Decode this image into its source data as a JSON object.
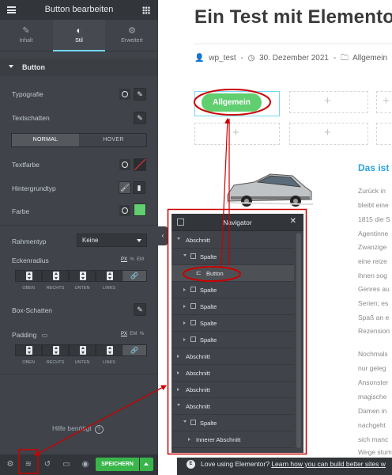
{
  "panel": {
    "title": "Button bearbeiten",
    "tabs": [
      {
        "label": "Inhalt",
        "icon": "pencil-icon"
      },
      {
        "label": "Stil",
        "icon": "contrast-icon"
      },
      {
        "label": "Erweitert",
        "icon": "gear-icon"
      }
    ],
    "section": "Button",
    "typography": "Typografie",
    "text_shadow": "Textschatten",
    "state_normal": "NORMAL",
    "state_hover": "HOVER",
    "text_color": "Textfarbe",
    "background_type": "Hintergrundtyp",
    "color": "Farbe",
    "color_value": "#61ce70",
    "border_type": "Rahmentyp",
    "border_type_value": "Keine",
    "corner_radius": "Eckenradius",
    "unit_px": "PX",
    "unit_percent": "%",
    "unit_em": "EM",
    "dim_top": "OBEN",
    "dim_right": "RECHTS",
    "dim_bottom": "UNTEN",
    "dim_left": "LINKS",
    "box_shadow": "Box-Schatten",
    "padding": "Padding",
    "help": "Hilfe benötigt",
    "save": "SPEICHERN"
  },
  "preview": {
    "title": "Ein Test mit Elementor",
    "author": "wp_test",
    "date": "30. Dezember 2021",
    "category": "Allgemein",
    "button_label": "Allgemein",
    "heading": "Das ist",
    "paragraph1": [
      "Zurück in",
      "bleibt eine",
      "1815 die S",
      "Agentinne",
      "Zwanzige",
      "eine reize",
      "ihnen sog",
      "Genres au",
      "Serien; es",
      "Spaß an e",
      "Rezension"
    ],
    "paragraph2": [
      "Nochmals",
      "nur geleg",
      "Ansonster",
      "magische",
      "Damen in",
      "nachgeht",
      "sich manc",
      "Wege stum"
    ],
    "notice": "Love using Elementor?",
    "notice_link": "Learn how you can build better sites w"
  },
  "navigator": {
    "title": "Navigator",
    "rows": [
      {
        "label": "Abschnitt"
      },
      {
        "label": "Spalte"
      },
      {
        "label": "Button"
      },
      {
        "label": "Spalte"
      },
      {
        "label": "Spalte"
      },
      {
        "label": "Spalte"
      },
      {
        "label": "Spalte"
      },
      {
        "label": "Abschnitt"
      },
      {
        "label": "Abschnitt"
      },
      {
        "label": "Abschnitt"
      },
      {
        "label": "Abschnitt"
      },
      {
        "label": "Spalte"
      },
      {
        "label": "Innerer Abschnitt"
      }
    ]
  }
}
